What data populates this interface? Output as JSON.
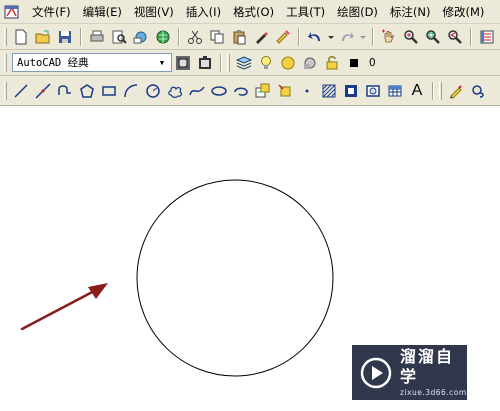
{
  "menubar": {
    "app_icon": "autocad-app-icon",
    "items": [
      "文件(F)",
      "编辑(E)",
      "视图(V)",
      "插入(I)",
      "格式(O)",
      "工具(T)",
      "绘图(D)",
      "标注(N)",
      "修改(M)"
    ]
  },
  "styles_toolbar": {
    "text_style_value": "AutoCAD 经典"
  },
  "layers_toolbar": {
    "current_layer": "0"
  },
  "draw_toolbar": {
    "text_tool_label": "A"
  },
  "watermark": {
    "title": "溜溜自学",
    "url": "zixue.3d66.com"
  },
  "colors": {
    "toolbar_bg": "#ece9d8",
    "arrow": "#8b1a1a",
    "watermark_bg": "#141c34"
  }
}
